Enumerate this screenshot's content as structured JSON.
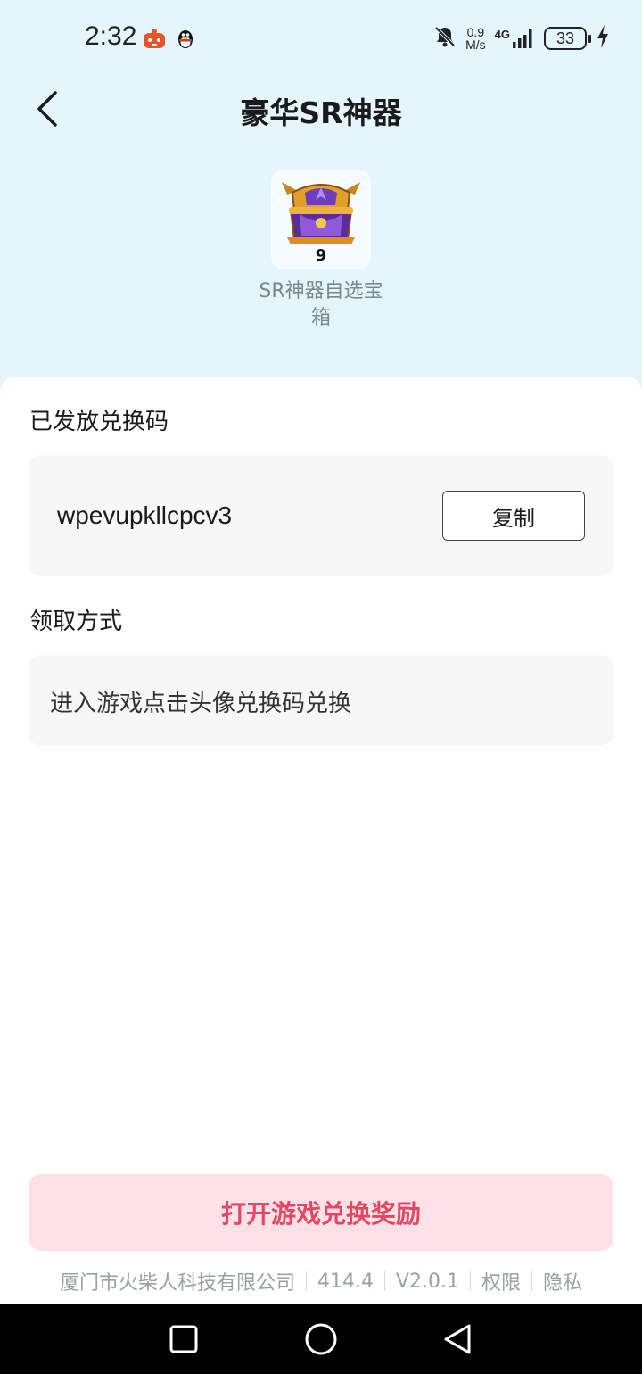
{
  "status_bar": {
    "time": "2:32",
    "app_icons": [
      "app-notification-icon",
      "qq-penguin-icon"
    ],
    "network_speed_value": "0.9",
    "network_speed_unit": "M/s",
    "network_type": "4G",
    "battery_level": "33",
    "icons": [
      "mute-bell-icon",
      "signal-icon",
      "charging-icon"
    ]
  },
  "header": {
    "title": "豪华SR神器",
    "back_icon": "chevron-left-icon"
  },
  "reward": {
    "icon": "treasure-chest-icon",
    "count": "9",
    "name": "SR神器自选宝箱"
  },
  "redeem": {
    "section_title": "已发放兑换码",
    "code": "wpevupkllcpcv3",
    "copy_label": "复制"
  },
  "method": {
    "section_title": "领取方式",
    "text": "进入游戏点击头像兑换码兑换"
  },
  "bottom": {
    "button_label": "打开游戏兑换奖励"
  },
  "footer": {
    "company": "厦门市火柴人科技有限公司",
    "number": "414.4",
    "version": "V2.0.1",
    "permissions": "权限",
    "privacy": "隐私"
  },
  "nav_bar": {
    "icons": [
      "recents-square-icon",
      "home-circle-icon",
      "back-triangle-icon"
    ]
  },
  "colors": {
    "header_bg": "#e4f5fb",
    "accent": "#e84563",
    "accent_bg": "#fde1e6",
    "card_bg": "#f7f7f7"
  }
}
